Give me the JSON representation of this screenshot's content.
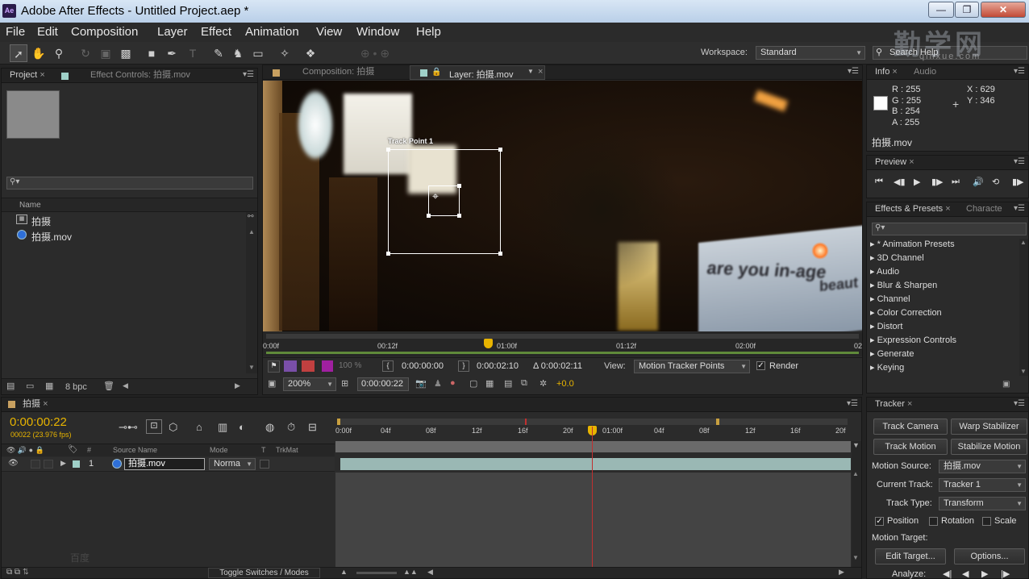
{
  "window": {
    "title": "Adobe After Effects - Untitled Project.aep *",
    "app_icon": "Ae"
  },
  "menu": [
    "File",
    "Edit",
    "Composition",
    "Layer",
    "Effect",
    "Animation",
    "View",
    "Window",
    "Help"
  ],
  "toolbar": {
    "workspace_label": "Workspace:",
    "workspace_value": "Standard",
    "search_placeholder": "Search Help"
  },
  "watermark": {
    "cn": "勤学网",
    "url": "qinxue.com",
    "bottom": "百度"
  },
  "project": {
    "tab_project": "Project",
    "tab_effect_controls": "Effect Controls: 拍摄.mov",
    "search_placeholder": "",
    "col_name": "Name",
    "items": [
      {
        "name": "拍摄",
        "kind": "comp"
      },
      {
        "name": "拍摄.mov",
        "kind": "footage"
      }
    ],
    "bpc": "8 bpc"
  },
  "viewer": {
    "tab_comp": "Composition: 拍摄",
    "tab_layer": "Layer: 拍摄.mov",
    "track_point_label": "Track Point 1",
    "ruler_labels": [
      "0:00f",
      "00:12f",
      "01:00f",
      "01:12f",
      "02:00f",
      "02"
    ],
    "in_time": "0:00:00:00",
    "out_time": "0:00:02:10",
    "duration": "Δ 0:00:02:11",
    "opacity": "100 %",
    "view_label": "View:",
    "view_value": "Motion Tracker Points",
    "render_label": "Render",
    "zoom": "200%",
    "current_time": "0:00:00:22",
    "exposure": "+0.0",
    "billboard_text": "are you in-age",
    "billboard_text2": "beaut"
  },
  "info": {
    "tab_info": "Info",
    "tab_audio": "Audio",
    "r": "R : 255",
    "g": "G : 255",
    "b": "B : 254",
    "a": "A : 255",
    "x": "X : 629",
    "y": "Y : 346",
    "file": "拍摄.mov"
  },
  "preview": {
    "tab": "Preview"
  },
  "effects": {
    "tab": "Effects & Presets",
    "tab_char": "Characte",
    "items": [
      "* Animation Presets",
      "3D Channel",
      "Audio",
      "Blur & Sharpen",
      "Channel",
      "Color Correction",
      "Distort",
      "Expression Controls",
      "Generate",
      "Keying"
    ]
  },
  "timeline": {
    "tab": "拍摄",
    "time": "0:00:00:22",
    "frames": "00022 (23.976 fps)",
    "col_source": "Source Name",
    "col_mode": "Mode",
    "col_t": "T",
    "col_trkmat": "TrkMat",
    "layer_num": "1",
    "layer_name": "拍摄.mov",
    "layer_mode": "Norma",
    "ruler_labels": [
      "0:00f",
      "04f",
      "08f",
      "12f",
      "16f",
      "20f",
      "01:00f",
      "04f",
      "08f",
      "12f",
      "16f",
      "20f"
    ],
    "toggle_label": "Toggle Switches / Modes"
  },
  "tracker": {
    "tab": "Tracker",
    "track_camera": "Track Camera",
    "warp_stabilizer": "Warp Stabilizer",
    "track_motion": "Track Motion",
    "stabilize_motion": "Stabilize Motion",
    "motion_source_label": "Motion Source:",
    "motion_source_value": "拍摄.mov",
    "current_track_label": "Current Track:",
    "current_track_value": "Tracker 1",
    "track_type_label": "Track Type:",
    "track_type_value": "Transform",
    "position": "Position",
    "rotation": "Rotation",
    "scale": "Scale",
    "motion_target_label": "Motion Target:",
    "edit_target": "Edit Target...",
    "options": "Options...",
    "analyze_label": "Analyze:"
  },
  "colors": {
    "accent_yellow": "#e8b400",
    "footage_blue": "#2e6fd8",
    "label_teal": "#9fd0c8"
  }
}
